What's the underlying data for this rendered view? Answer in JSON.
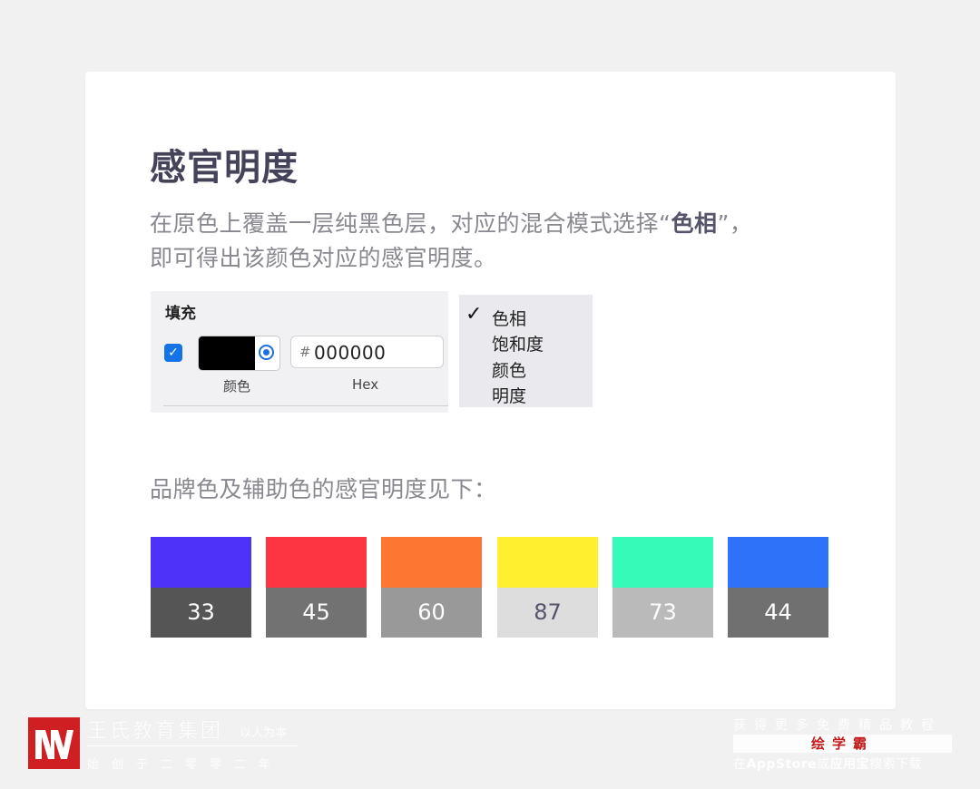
{
  "title": "感官明度",
  "description": {
    "part1": "在原色上覆盖一层纯黑色层，对应的混合模式选择“",
    "bold": "色相",
    "part2": "”，",
    "line2": "即可得出该颜色对应的感官明度。"
  },
  "fill_panel": {
    "label": "填充",
    "checkbox_checked": true,
    "swatch_color": "#000000",
    "hex_hash": "#",
    "hex_value": "000000",
    "color_caption": "颜色",
    "hex_caption": "Hex"
  },
  "blend_menu": {
    "check": "✓",
    "items": [
      "色相",
      "饱和度",
      "颜色",
      "明度"
    ],
    "selected_index": 0
  },
  "sub_heading": "品牌色及辅助色的感官明度见下：",
  "swatches": [
    {
      "color": "#4f32f7",
      "lightness_color": "#555555",
      "value": "33"
    },
    {
      "color": "#fd3441",
      "lightness_color": "#727272",
      "value": "45"
    },
    {
      "color": "#fe7732",
      "lightness_color": "#999999",
      "value": "60"
    },
    {
      "color": "#ffef2f",
      "lightness_color": "#dddddd",
      "value": "87"
    },
    {
      "color": "#35fab8",
      "lightness_color": "#bababa",
      "value": "73"
    },
    {
      "color": "#2d72f8",
      "lightness_color": "#707070",
      "value": "44"
    }
  ],
  "footer": {
    "brand": "王氏教育集团",
    "slogan": "以人为本",
    "founded": "始创于二零零二年",
    "right_line1": "获得更多免费精品教程",
    "right_line2": "绘学霸",
    "right_line3_a": "在",
    "right_line3_b": "AppStore",
    "right_line3_c": "或",
    "right_line3_d": "应用宝",
    "right_line3_e": "搜索下载",
    "accent": "#cf1f22"
  }
}
